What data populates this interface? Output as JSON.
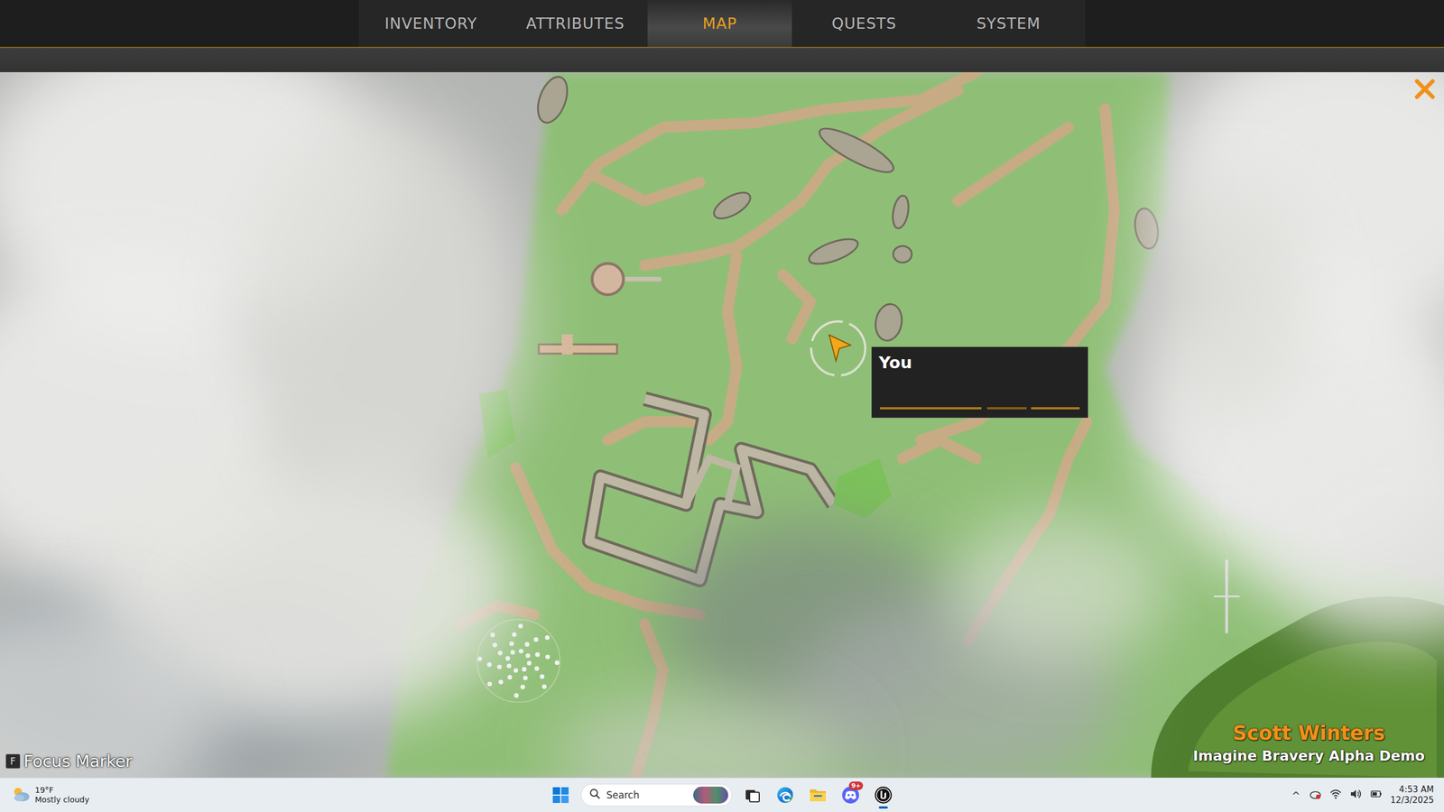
{
  "tabs": [
    {
      "label": "INVENTORY",
      "selected": false
    },
    {
      "label": "ATTRIBUTES",
      "selected": false
    },
    {
      "label": "MAP",
      "selected": true
    },
    {
      "label": "QUESTS",
      "selected": false
    },
    {
      "label": "SYSTEM",
      "selected": false
    }
  ],
  "map": {
    "player": {
      "label": "You"
    }
  },
  "hint": {
    "key": "F",
    "label": "Focus Marker"
  },
  "watermark": {
    "name": "Scott Winters",
    "subtitle": "Imagine Bravery Alpha Demo"
  },
  "taskbar": {
    "weather": {
      "temp": "19°F",
      "desc": "Mostly cloudy"
    },
    "search": "Search",
    "apps": [
      {
        "kind": "taskview",
        "active": false,
        "badge": ""
      },
      {
        "kind": "edge",
        "active": false,
        "badge": ""
      },
      {
        "kind": "explorer",
        "active": false,
        "badge": ""
      },
      {
        "kind": "discord",
        "active": false,
        "badge": "9+"
      },
      {
        "kind": "unreal",
        "active": true,
        "badge": ""
      }
    ],
    "tray": {
      "chevron": "^"
    },
    "clock": {
      "time": "4:53 AM",
      "date": "12/3/2025"
    }
  }
}
